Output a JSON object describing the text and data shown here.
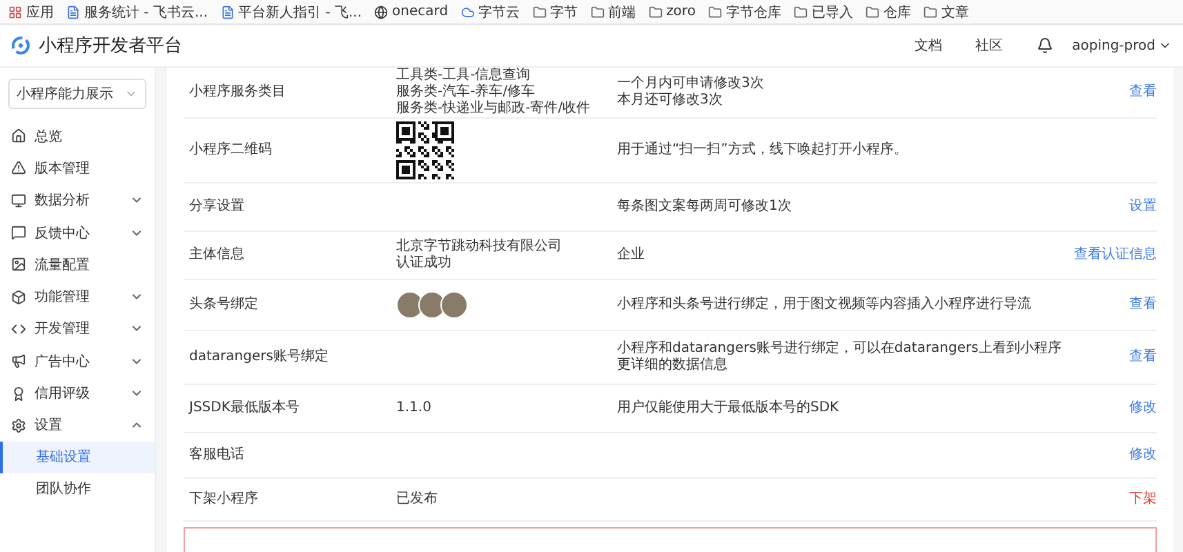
{
  "bookmarks": [
    {
      "label": "应用",
      "kind": "apps"
    },
    {
      "label": "服务统计 - 飞书云...",
      "kind": "doc"
    },
    {
      "label": "平台新人指引 - 飞...",
      "kind": "doc"
    },
    {
      "label": "onecard",
      "kind": "globe"
    },
    {
      "label": "字节云",
      "kind": "cloud"
    },
    {
      "label": "字节",
      "kind": "folder"
    },
    {
      "label": "前端",
      "kind": "folder"
    },
    {
      "label": "zoro",
      "kind": "folder"
    },
    {
      "label": "字节仓库",
      "kind": "folder"
    },
    {
      "label": "已导入",
      "kind": "folder"
    },
    {
      "label": "仓库",
      "kind": "folder"
    },
    {
      "label": "文章",
      "kind": "folder"
    }
  ],
  "header": {
    "title": "小程序开发者平台",
    "links": [
      "文档",
      "社区"
    ],
    "user": "aoping-prod"
  },
  "sidebar": {
    "app_select": "小程序能力展示",
    "items": [
      {
        "label": "总览"
      },
      {
        "label": "版本管理"
      },
      {
        "label": "数据分析",
        "expanded": false
      },
      {
        "label": "反馈中心",
        "expanded": false
      },
      {
        "label": "流量配置"
      },
      {
        "label": "功能管理",
        "expanded": false
      },
      {
        "label": "开发管理",
        "expanded": false
      },
      {
        "label": "广告中心",
        "expanded": false
      },
      {
        "label": "信用评级",
        "expanded": false
      },
      {
        "label": "设置",
        "expanded": true,
        "children": [
          {
            "label": "基础设置",
            "selected": true
          },
          {
            "label": "团队协作",
            "selected": false
          }
        ]
      }
    ]
  },
  "rows": [
    {
      "label": "小程序服务类目",
      "value": {
        "kind": "text",
        "lines": [
          "工具类-工具-信息查询",
          "服务类-汽车-养车/修车",
          "服务类-快递业与邮政-寄件/收件"
        ]
      },
      "description": [
        "一个月内可申请修改3次",
        "本月还可修改3次"
      ],
      "action": {
        "label": "查看",
        "kind": "link"
      }
    },
    {
      "label": "小程序二维码",
      "value": {
        "kind": "qr"
      },
      "description": [
        "用于通过“扫一扫”方式，线下唤起打开小程序。"
      ]
    },
    {
      "label": "分享设置",
      "description": [
        "每条图文案每两周可修改1次"
      ],
      "action": {
        "label": "设置",
        "kind": "link"
      }
    },
    {
      "label": "主体信息",
      "value": {
        "kind": "text",
        "lines": [
          "北京字节跳动科技有限公司",
          "认证成功"
        ]
      },
      "description": [
        "企业"
      ],
      "action": {
        "label": "查看认证信息",
        "kind": "link"
      }
    },
    {
      "label": "头条号绑定",
      "value": {
        "kind": "avatars"
      },
      "description": [
        "小程序和头条号进行绑定，用于图文视频等内容插入小程序进行导流"
      ],
      "action": {
        "label": "查看",
        "kind": "link"
      }
    },
    {
      "label": "datarangers账号绑定",
      "description": [
        "小程序和datarangers账号进行绑定，可以在datarangers上看到小程序更详细的数据信息"
      ],
      "action": {
        "label": "查看",
        "kind": "link"
      }
    },
    {
      "label": "JSSDK最低版本号",
      "value": {
        "kind": "text",
        "lines": [
          "1.1.0"
        ]
      },
      "description": [
        "用户仅能使用大于最低版本号的SDK"
      ],
      "action": {
        "label": "修改",
        "kind": "link"
      }
    },
    {
      "label": "客服电话",
      "action": {
        "label": "修改",
        "kind": "link"
      }
    },
    {
      "label": "下架小程序",
      "value": {
        "kind": "text",
        "lines": [
          "已发布"
        ]
      },
      "action": {
        "label": "下架",
        "kind": "danger"
      }
    }
  ]
}
